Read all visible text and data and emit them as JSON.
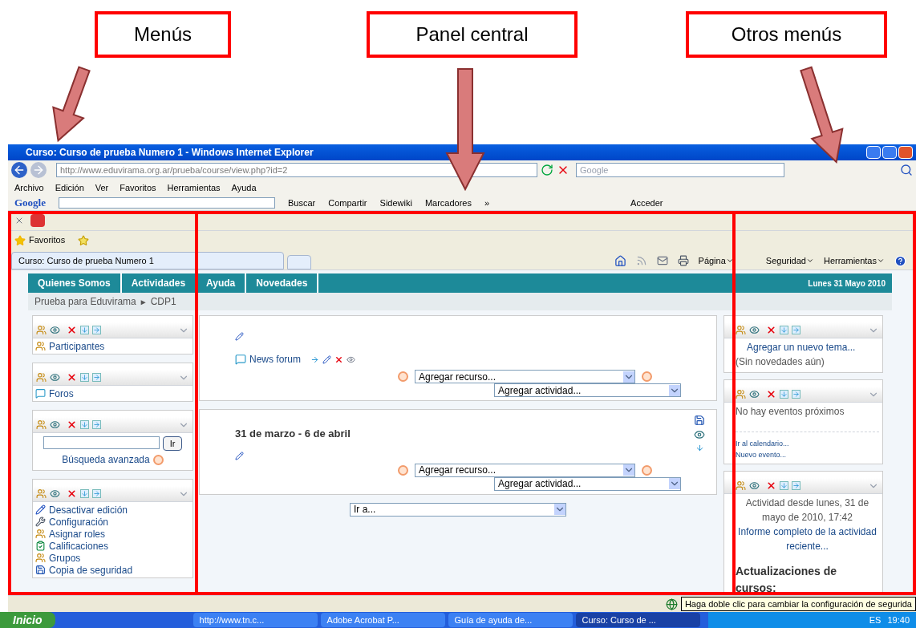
{
  "annotations": [
    {
      "label": "Menús"
    },
    {
      "label": "Panel central"
    },
    {
      "label": "Otros menús"
    }
  ],
  "browser": {
    "title": "Curso: Curso de prueba Numero 1 - Windows Internet Explorer",
    "url": "http://www.eduvirama.org.ar/prueba/course/view.php?id=2",
    "search_placeholder": "Google",
    "menu_bar": [
      "Archivo",
      "Edición",
      "Ver",
      "Favoritos",
      "Herramientas",
      "Ayuda"
    ],
    "google_toolbar": {
      "logo": "Google",
      "items": [
        "Buscar",
        "Compartir",
        "Sidewiki",
        "Marcadores",
        "»",
        "Acceder"
      ]
    },
    "favorites": "Favoritos",
    "tabs": [
      {
        "label": "Curso: Curso de prueba Numero 1",
        "selected": true
      }
    ],
    "command_bar": [
      "Página",
      "Seguridad",
      "Herramientas"
    ]
  },
  "page": {
    "nav": [
      "Quienes Somos",
      "Actividades",
      "Ayuda",
      "Novedades"
    ],
    "date": "Lunes 31 Mayo 2010",
    "breadcrumb": [
      "Prueba para Eduvirama",
      "►",
      "CDP1"
    ],
    "left_blocks": [
      {
        "kind": "links",
        "items": [
          {
            "label": "Participantes"
          }
        ]
      },
      {
        "kind": "links",
        "items": [
          {
            "label": "Foros"
          }
        ]
      },
      {
        "kind": "search",
        "button": "Ir",
        "link": "Búsqueda avanzada"
      },
      {
        "kind": "links",
        "items": [
          {
            "label": "Desactivar edición"
          },
          {
            "label": "Configuración"
          },
          {
            "label": "Asignar roles"
          },
          {
            "label": "Calificaciones"
          },
          {
            "label": "Grupos"
          },
          {
            "label": "Copia de seguridad"
          }
        ]
      }
    ],
    "sections": [
      {
        "forum": "News forum",
        "recurso": "Agregar recurso...",
        "actividad": "Agregar actividad..."
      },
      {
        "title": "31 de marzo - 6 de abril",
        "recurso": "Agregar recurso...",
        "actividad": "Agregar actividad..."
      }
    ],
    "jump": "Ir a...",
    "right_blocks": [
      {
        "lines": [
          {
            "text": "Agregar un nuevo tema...",
            "kind": "link"
          },
          {
            "text": "(Sin novedades aún)",
            "kind": "note"
          }
        ]
      },
      {
        "lines": [
          {
            "text": "No hay eventos próximos",
            "kind": "note"
          },
          {
            "text": "Ir al calendario...",
            "kind": "small-link"
          },
          {
            "text": "Nuevo evento...",
            "kind": "small-link"
          }
        ]
      },
      {
        "lines": [
          {
            "text": "Actividad desde lunes, 31 de mayo de 2010, 17:42",
            "kind": "centered"
          },
          {
            "text": "Informe completo de la actividad reciente...",
            "kind": "centered-link"
          },
          {
            "text": "Actualizaciones de cursos:",
            "kind": "heading"
          }
        ]
      }
    ]
  },
  "status": {
    "tooltip": "Haga doble clic para cambiar la configuración de segurida"
  },
  "taskbar": {
    "start": "Inicio",
    "tasks": [
      {
        "label": "http://www.tn.c...",
        "selected": false
      },
      {
        "label": "Adobe Acrobat P...",
        "selected": false
      },
      {
        "label": "Guía de ayuda de...",
        "selected": false
      },
      {
        "label": "Curso: Curso de ...",
        "selected": true
      }
    ],
    "lang": "ES",
    "clock": "19:40"
  }
}
